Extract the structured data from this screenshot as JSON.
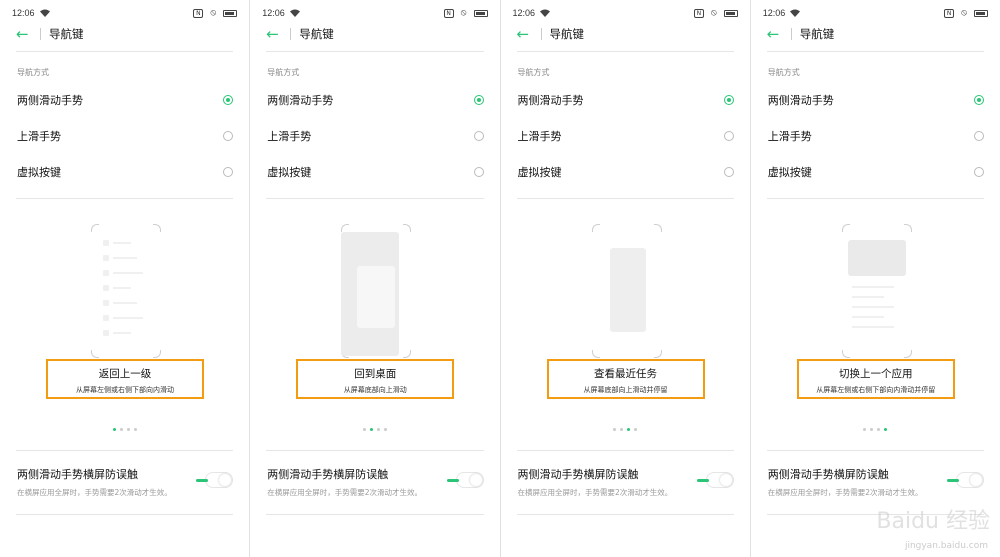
{
  "panels": [
    {
      "status_time": "12:06",
      "title": "导航键",
      "section_label": "导航方式",
      "options": [
        "两侧滑动手势",
        "上滑手势",
        "虚拟按键"
      ],
      "selected_index": 0,
      "caption_title": "返回上一级",
      "caption_sub": "从屏幕左侧或右侧下部向内滑动",
      "dots_total": 4,
      "dot_active": 0,
      "toggle_title": "两侧滑动手势横屏防误触",
      "toggle_desc": "在横屏应用全屏时，手势需要2次滑动才生效。"
    },
    {
      "status_time": "12:06",
      "title": "导航键",
      "section_label": "导航方式",
      "options": [
        "两侧滑动手势",
        "上滑手势",
        "虚拟按键"
      ],
      "selected_index": 0,
      "caption_title": "回到桌面",
      "caption_sub": "从屏幕底部向上滑动",
      "dots_total": 4,
      "dot_active": 1,
      "toggle_title": "两侧滑动手势横屏防误触",
      "toggle_desc": "在横屏应用全屏时，手势需要2次滑动才生效。"
    },
    {
      "status_time": "12:06",
      "title": "导航键",
      "section_label": "导航方式",
      "options": [
        "两侧滑动手势",
        "上滑手势",
        "虚拟按键"
      ],
      "selected_index": 0,
      "caption_title": "查看最近任务",
      "caption_sub": "从屏幕底部向上滑动并停留",
      "dots_total": 4,
      "dot_active": 2,
      "toggle_title": "两侧滑动手势横屏防误触",
      "toggle_desc": "在横屏应用全屏时，手势需要2次滑动才生效。"
    },
    {
      "status_time": "12:06",
      "title": "导航键",
      "section_label": "导航方式",
      "options": [
        "两侧滑动手势",
        "上滑手势",
        "虚拟按键"
      ],
      "selected_index": 0,
      "caption_title": "切换上一个应用",
      "caption_sub": "从屏幕左侧或右侧下部向内滑动并停留",
      "dots_total": 4,
      "dot_active": 3,
      "toggle_title": "两侧滑动手势横屏防误触",
      "toggle_desc": "在横屏应用全屏时，手势需要2次滑动才生效。"
    }
  ],
  "watermark": {
    "text": "Baidu 经验",
    "url": "jingyan.baidu.com"
  },
  "colors": {
    "accent": "#2bc577",
    "highlight_border": "#f39c12"
  }
}
